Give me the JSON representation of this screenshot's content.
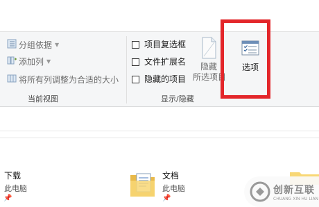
{
  "ribbon": {
    "current_view": {
      "group_label": "当前视图",
      "group_by": "分组依据",
      "add_columns": "添加列",
      "size_all_columns": "将所有列调整为合适的大小"
    },
    "show_hide": {
      "group_label": "显示/隐藏",
      "item_checkboxes": "项目复选框",
      "file_extensions": "文件扩展名",
      "hidden_items": "隐藏的项目",
      "hide_selected_line1": "隐藏",
      "hide_selected_line2": "所选项目",
      "options_label": "选项"
    }
  },
  "files": [
    {
      "name": "下载",
      "location": "此电脑",
      "icon": "download-folder-icon"
    },
    {
      "name": "文档",
      "location": "此电脑",
      "icon": "documents-folder-icon"
    }
  ],
  "watermark": {
    "text": "创新互联",
    "sub": "CHUANG XIN HU LIAN"
  },
  "colors": {
    "highlight": "#e3262a",
    "ribbon_bg": "#f5f6f7",
    "folder_yellow": "#f8d775"
  }
}
